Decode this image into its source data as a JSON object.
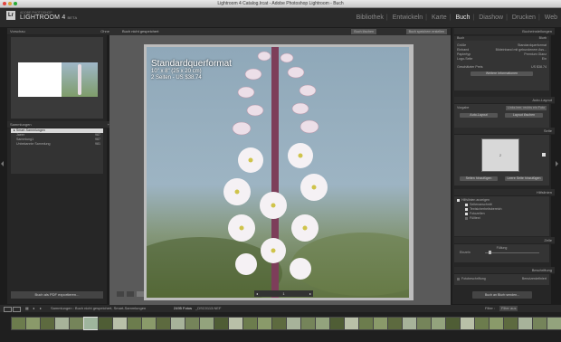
{
  "window": {
    "title": "Lightroom 4 Catalog.lrcat - Adobe Photoshop Lightroom - Buch"
  },
  "brand": {
    "small": "ADOBE PHOTOSHOP",
    "main": "LIGHTROOM 4",
    "beta": "BETA",
    "logo": "Lr"
  },
  "modules": [
    "Bibliothek",
    "Entwickeln",
    "Karte",
    "Buch",
    "Diashow",
    "Drucken",
    "Web"
  ],
  "active_module": "Buch",
  "left": {
    "preview_title": "Vorschau",
    "preview_sub": "Ohne",
    "collections_title": "Sammlungen",
    "collections": [
      {
        "name": "Smart-Sammlungen",
        "count": ""
      },
      {
        "name": "Jaeer",
        "count": "987"
      },
      {
        "name": "Sammlung1",
        "count": "987"
      },
      {
        "name": "Unbekannte Sammlung",
        "count": "981"
      }
    ],
    "export_button": "Buch als PDF exportieren..."
  },
  "center": {
    "status": "Buch nicht gespeichert",
    "clear_button": "Buch löschen",
    "create_button": "Buch speichern erstellen",
    "page_title": "Standardquerformat",
    "page_size": "10\" x 8\" (25 x 20 cm)",
    "page_info": "2 Seiten - US $38.74",
    "page_number": "1"
  },
  "right": {
    "book_settings_title": "Bucheinstellungen",
    "book_label": "Buch",
    "book_value": "Blurb",
    "fields": [
      {
        "label": "Größe",
        "value": "Standardquerformat"
      },
      {
        "label": "Einband",
        "value": "Bildeinband mit gebundenem Ass..."
      },
      {
        "label": "Papiertyp",
        "value": "Premium Glanz"
      },
      {
        "label": "Logo-Seite",
        "value": "Ein"
      }
    ],
    "price_label": "Geschätzter Preis",
    "price_value": "US $38.74",
    "price_button": "Weitere Informationen",
    "auto_layout_title": "Auto-Layout",
    "preset_label": "Vorgabe",
    "preset_value": "Links leer, rechts ein Foto",
    "autolayout_btn1": "Auto-Layout",
    "autolayout_btn2": "Layout löschen",
    "page_title": "Seite",
    "page_num": "2",
    "page_btn1": "Seiten hinzufügen",
    "page_btn2": "Leere Seite hinzufügen",
    "guides_title": "Hilfslinien",
    "guides_show": "Hilfslinien anzeigen",
    "guides": [
      "Seitenanschnitt",
      "Textsicherheitsbereich",
      "Fotozellen",
      "Fülltext"
    ],
    "cell_title": "Zelle",
    "cell_padding": "Füllung",
    "cell_sub": "Einzeln",
    "caption_title": "Beschriftung",
    "caption_label": "Fotobeschriftung",
    "caption_value": "Benutzerdefiniert",
    "send_button": "Buch an Blurb senden..."
  },
  "toolbar": {
    "source": "Sammlungen : Buch nicht gespeichert, Smart-Sammlungen",
    "count": "2495 Fotos",
    "file": "_DSC0113.NEF",
    "filter_label": "Filter :",
    "filter_value": "Filter aus"
  },
  "colors": {
    "accent": "#e6e6e6",
    "panel": "#3a3a3a",
    "bg": "#1c1c1c"
  }
}
